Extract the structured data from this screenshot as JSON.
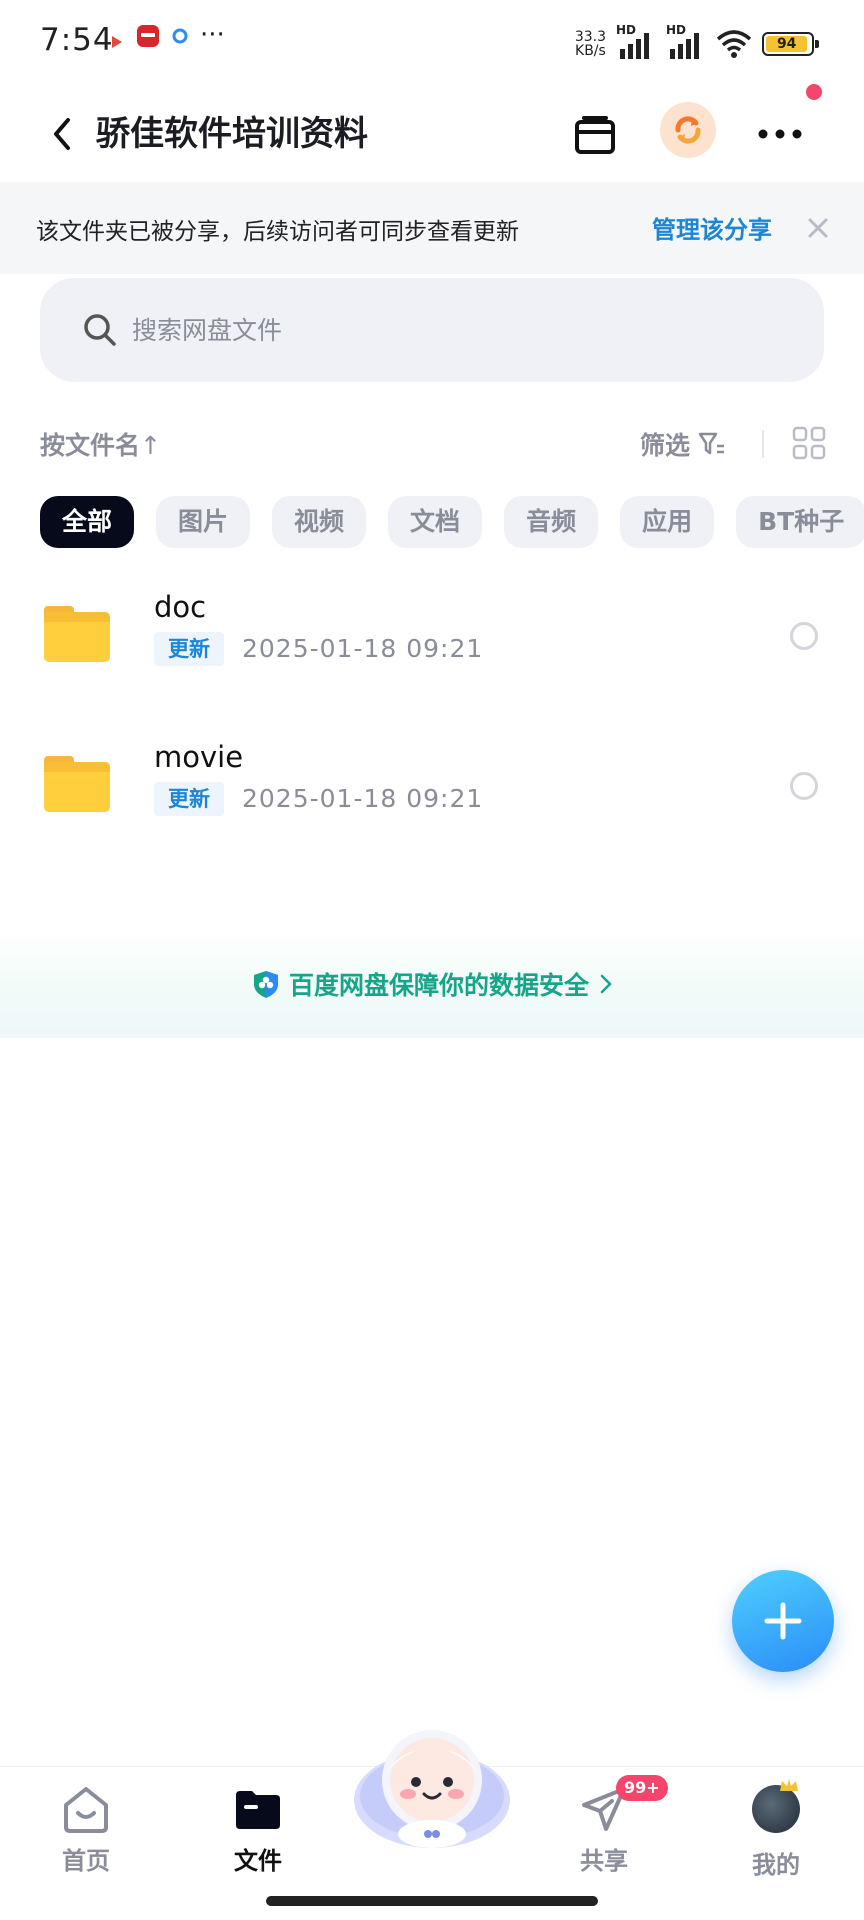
{
  "status_bar": {
    "time": "7:54",
    "more": "···",
    "network_speed_value": "33.3",
    "network_speed_unit": "KB/s",
    "signal_1_label": "HD",
    "signal_2_label": "HD",
    "battery": "94",
    "battery_fill_color": "#f4c430"
  },
  "header": {
    "title": "骄佳软件培训资料"
  },
  "share_banner": {
    "text": "该文件夹已被分享，后续访问者可同步查看更新",
    "link": "管理该分享"
  },
  "search": {
    "placeholder": "搜索网盘文件"
  },
  "sort": {
    "label": "按文件名",
    "arrow": "↑",
    "filter": "筛选"
  },
  "categories": [
    "全部",
    "图片",
    "视频",
    "文档",
    "音频",
    "应用",
    "BT种子"
  ],
  "files": [
    {
      "name": "doc",
      "badge": "更新",
      "date": "2025-01-18  09:21"
    },
    {
      "name": "movie",
      "badge": "更新",
      "date": "2025-01-18  09:21"
    }
  ],
  "security": {
    "text": "百度网盘保障你的数据安全",
    "accent": "#17a58a"
  },
  "bottom_nav": {
    "items": [
      {
        "label": "首页",
        "icon": "home-icon"
      },
      {
        "label": "文件",
        "icon": "folder-icon"
      },
      {
        "label": "共享",
        "icon": "send-icon",
        "badge": "99+"
      },
      {
        "label": "我的",
        "icon": "avatar"
      }
    ]
  },
  "colors": {
    "accent_blue": "#1c86d6",
    "chip_active": "#070a1a",
    "badge_red": "#f5456b"
  }
}
